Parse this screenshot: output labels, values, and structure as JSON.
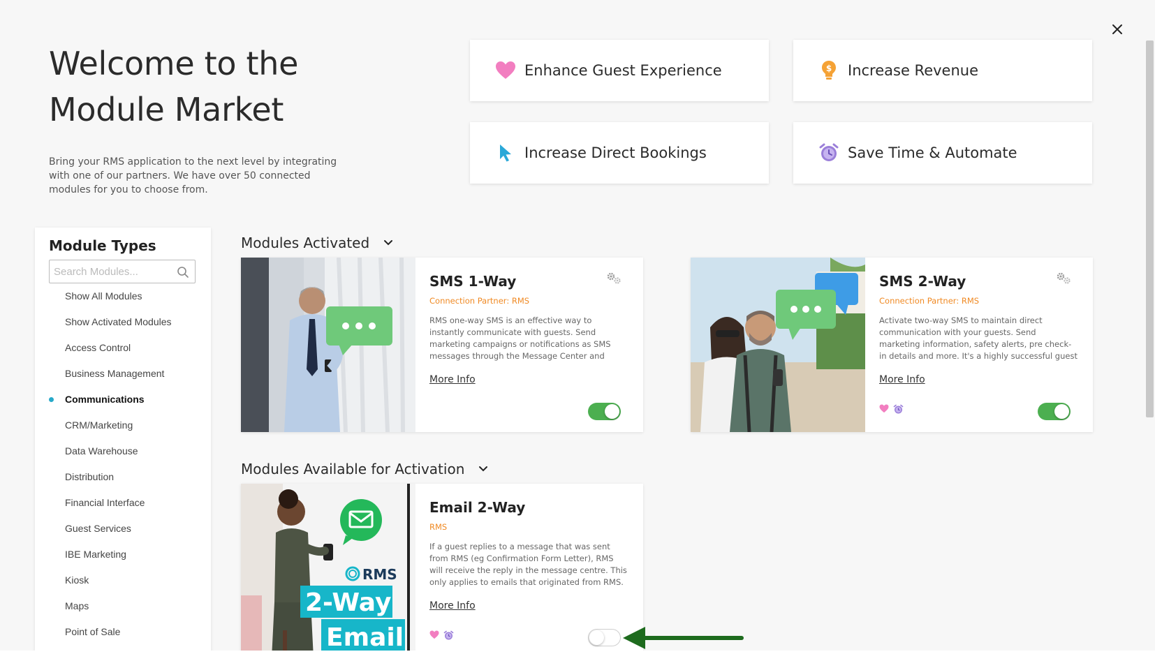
{
  "welcome": {
    "title_line1": "Welcome to the",
    "title_line2": "Module Market",
    "description": "Bring your RMS application to the next level by integrating with one of our partners. We have over 50 connected modules for you to choose from."
  },
  "goals": [
    {
      "label": "Enhance Guest Experience",
      "icon": "heart-icon",
      "color": "#f27ec0"
    },
    {
      "label": "Increase Revenue",
      "icon": "dollar-bulb-icon",
      "color": "#f5a235"
    },
    {
      "label": "Increase Direct Bookings",
      "icon": "cursor-icon",
      "color": "#2aa8d8"
    },
    {
      "label": "Save Time & Automate",
      "icon": "alarm-clock-icon",
      "color": "#9b7fd9"
    }
  ],
  "sidebar": {
    "title": "Module Types",
    "search_placeholder": "Search Modules...",
    "items": [
      {
        "label": "Show All Modules"
      },
      {
        "label": "Show Activated Modules"
      },
      {
        "label": "Access Control"
      },
      {
        "label": "Business Management"
      },
      {
        "label": "Communications",
        "active": true
      },
      {
        "label": "CRM/Marketing"
      },
      {
        "label": "Data Warehouse"
      },
      {
        "label": "Distribution"
      },
      {
        "label": "Financial Interface"
      },
      {
        "label": "Guest Services"
      },
      {
        "label": "IBE Marketing"
      },
      {
        "label": "Kiosk"
      },
      {
        "label": "Maps"
      },
      {
        "label": "Point of Sale"
      }
    ]
  },
  "sections": {
    "activated": "Modules Activated",
    "available": "Modules Available for Activation"
  },
  "modules": {
    "sms1": {
      "title": "SMS 1-Way",
      "partner": "Connection Partner: RMS",
      "description": "RMS one-way SMS is an effective way to instantly communicate with guests. Send marketing campaigns or notifications as SMS messages through the Message Center and Triggered...",
      "more_info": "More Info",
      "enabled": true
    },
    "sms2": {
      "title": "SMS 2-Way",
      "partner": "Connection Partner: RMS",
      "description": "Activate two-way SMS to maintain direct communication with your guests. Send marketing information, safety alerts, pre check-in details and more. It's a highly successful guest engagement...",
      "more_info": "More Info",
      "tags": [
        "heart-icon",
        "alarm-clock-icon"
      ],
      "enabled": true
    },
    "email2": {
      "title": "Email 2-Way",
      "partner": "RMS",
      "description": "If a guest replies to a message that was sent from RMS (eg Confirmation Form Letter), RMS will receive the reply in the message centre. This only applies to emails that originated from RMS.",
      "more_info": "More Info",
      "tags": [
        "heart-icon",
        "alarm-clock-icon"
      ],
      "enabled": false,
      "image_text": {
        "brand": "RMS",
        "line1": "2-Way",
        "line2": "Email"
      }
    }
  },
  "colors": {
    "accent_dot": "#27a9c9",
    "partner_orange": "#f08a24",
    "toggle_on": "#4caf50",
    "arrow_green": "#1e6b1e"
  }
}
